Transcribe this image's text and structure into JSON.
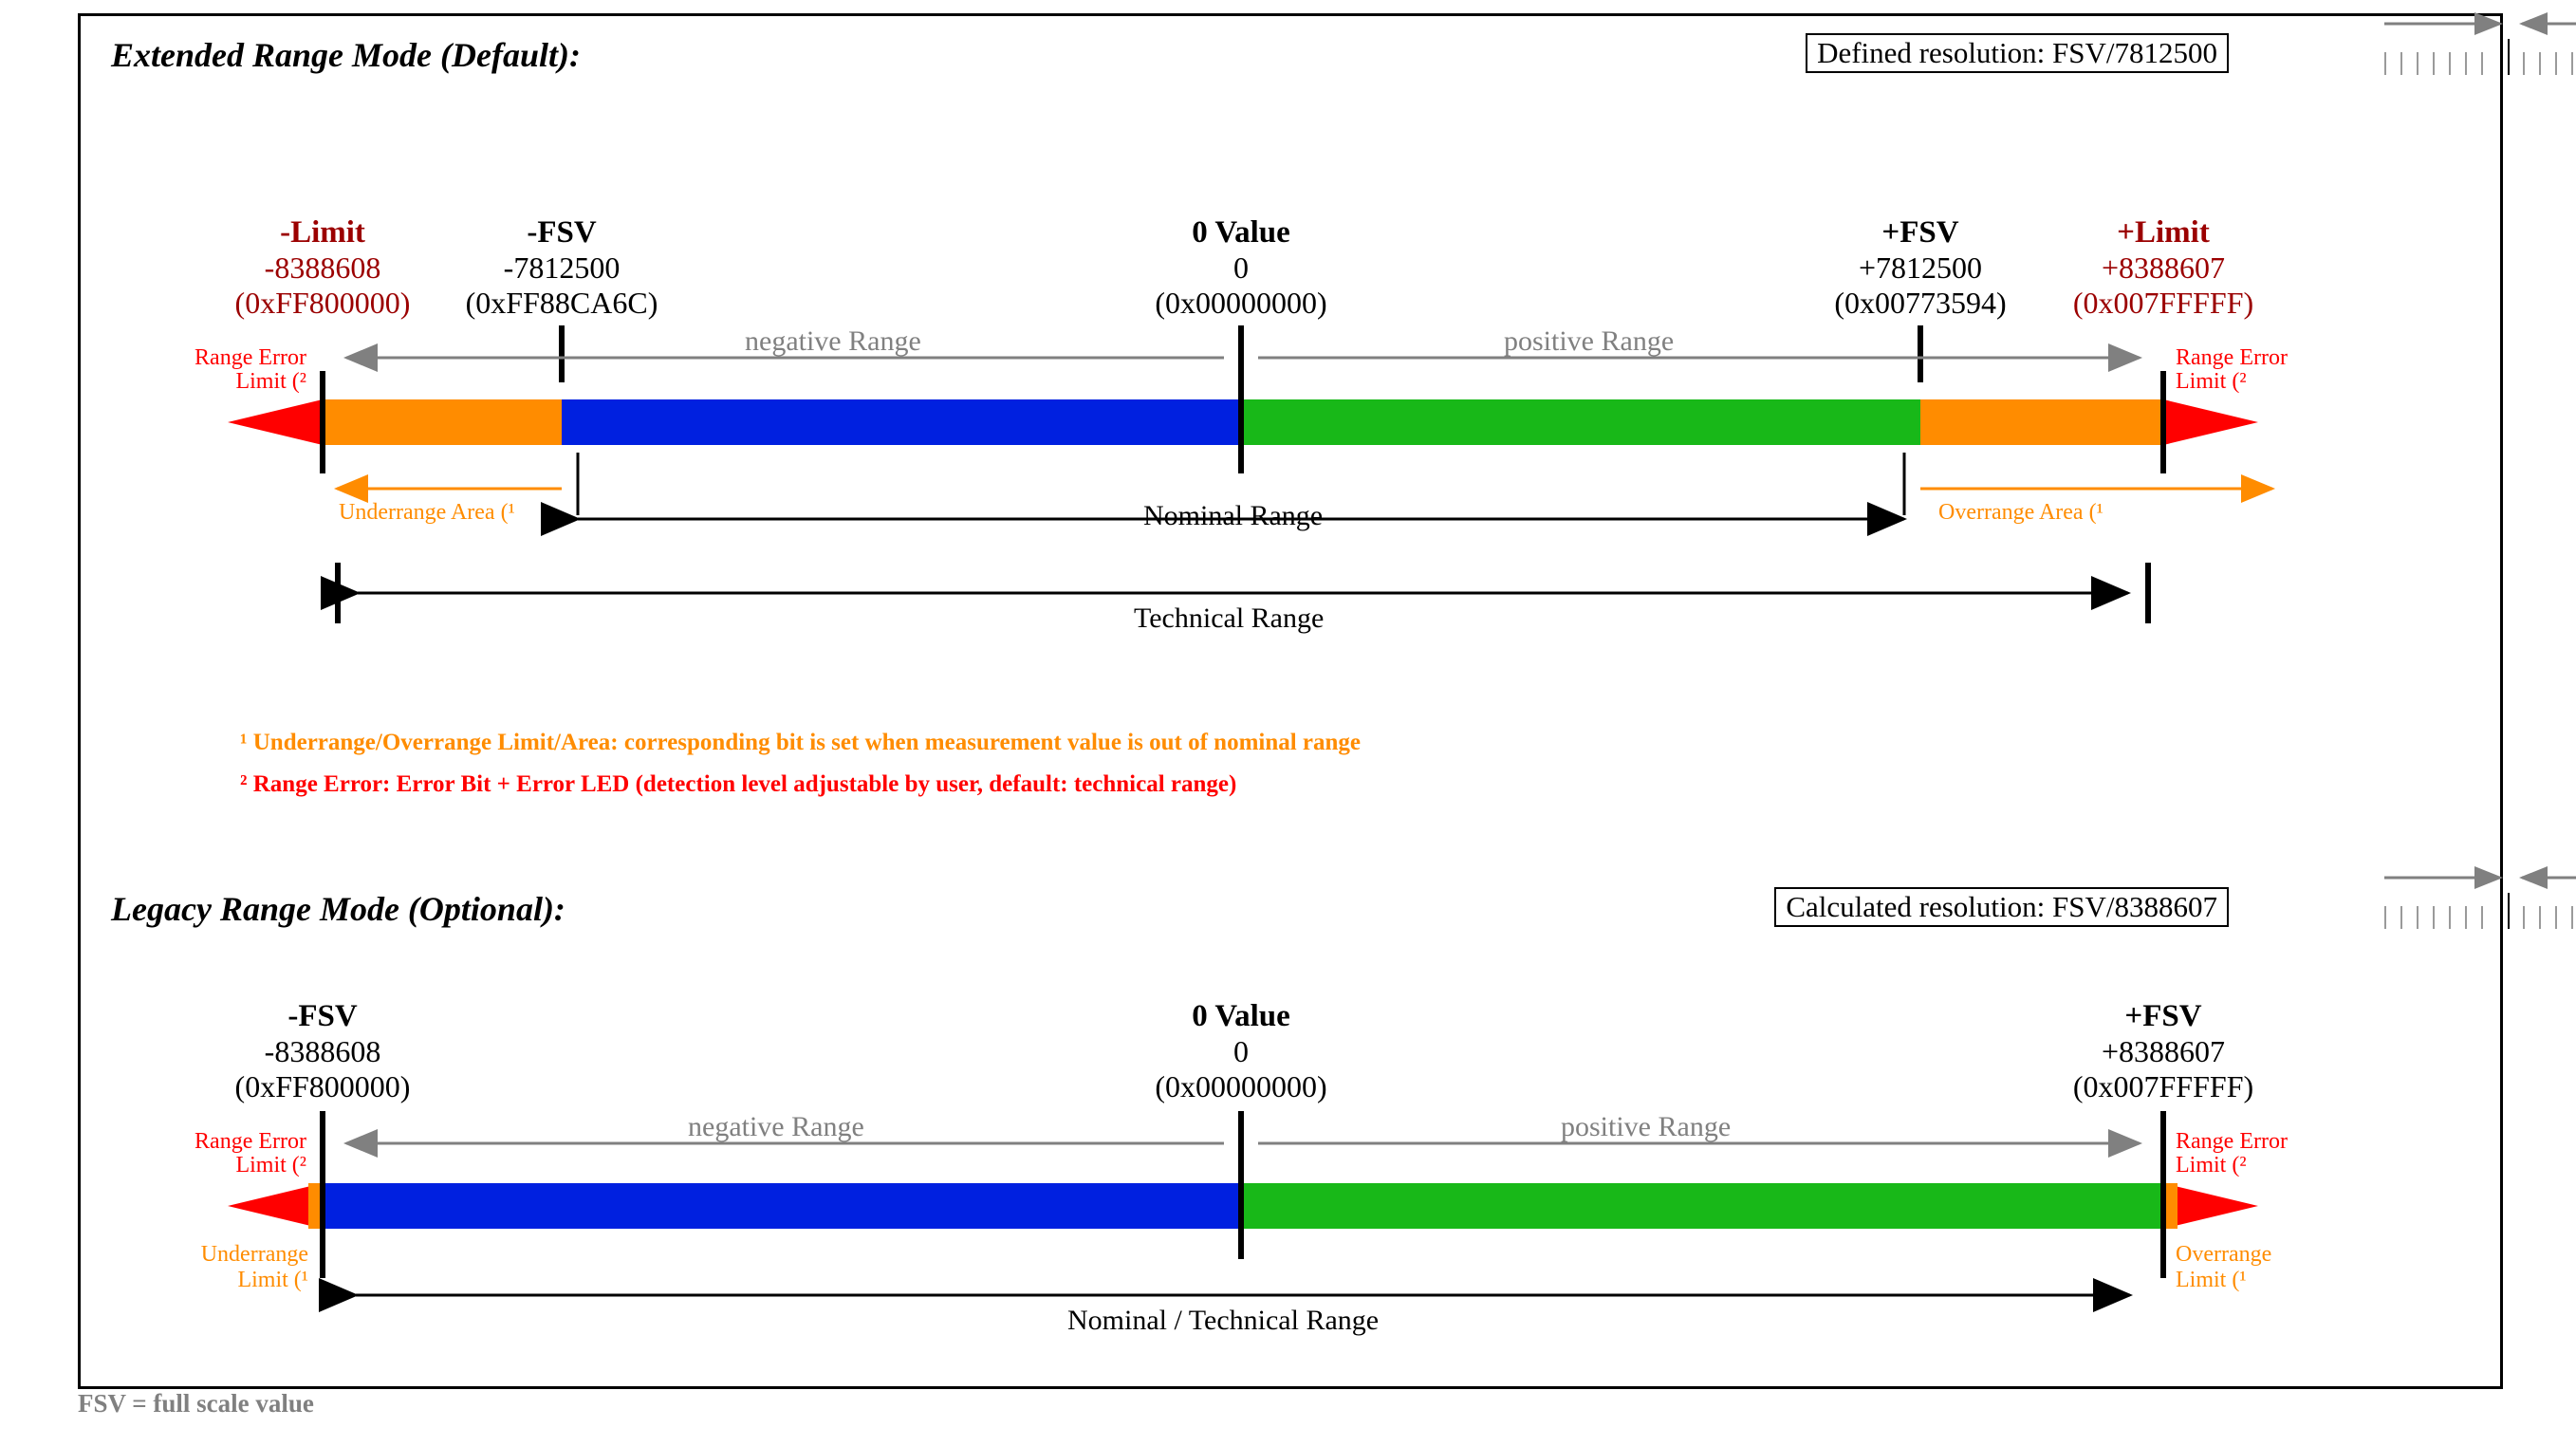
{
  "ext": {
    "heading": "Extended Range Mode (Default):",
    "resolution": "Defined resolution:  FSV/7812500",
    "neg_limit": {
      "t": "-Limit",
      "v": "-8388608",
      "h": "(0xFF800000)"
    },
    "neg_fsv": {
      "t": "-FSV",
      "v": "-7812500",
      "h": "(0xFF88CA6C)"
    },
    "zero": {
      "t": "0 Value",
      "v": "0",
      "h": "(0x00000000)"
    },
    "pos_fsv": {
      "t": "+FSV",
      "v": "+7812500",
      "h": "(0x00773594)"
    },
    "pos_limit": {
      "t": "+Limit",
      "v": "+8388607",
      "h": "(0x007FFFFF)"
    },
    "neg_range": "negative Range",
    "pos_range": "positive Range",
    "range_err_l": "Range Error\nLimit (²",
    "range_err_r": "Range Error\nLimit (²",
    "under": "Underrange Area (¹",
    "over": "Overrange Area (¹",
    "nominal": "Nominal Range",
    "technical": "Technical Range"
  },
  "notes": {
    "n1": "¹ Underrange/Overrange Limit/Area: corresponding bit is set when measurement value is out of nominal range",
    "n2": "² Range Error: Error Bit + Error LED (detection level adjustable by user, default: technical range)"
  },
  "leg": {
    "heading": "Legacy Range Mode (Optional):",
    "resolution": "Calculated resolution:  FSV/8388607",
    "neg_fsv": {
      "t": "-FSV",
      "v": "-8388608",
      "h": "(0xFF800000)"
    },
    "zero": {
      "t": "0 Value",
      "v": "0",
      "h": "(0x00000000)"
    },
    "pos_fsv": {
      "t": "+FSV",
      "v": "+8388607",
      "h": "(0x007FFFFF)"
    },
    "neg_range": "negative Range",
    "pos_range": "positive Range",
    "range_err_l": "Range Error\nLimit (²",
    "range_err_r": "Range Error\nLimit (²",
    "under": "Underrange\nLimit (¹",
    "over": "Overrange\nLimit (¹",
    "nominal": "Nominal / Technical Range"
  },
  "footer": "FSV = full scale value"
}
